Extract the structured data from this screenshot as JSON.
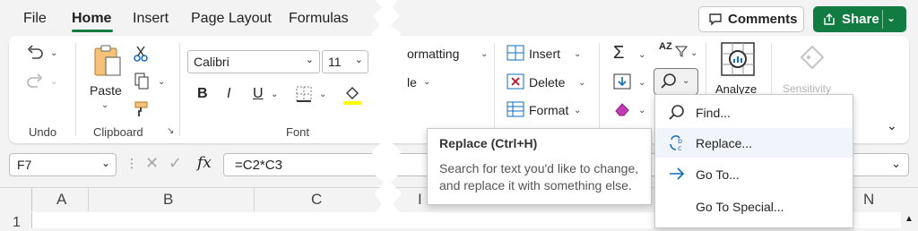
{
  "menu": {
    "tabs": [
      "File",
      "Home",
      "Insert",
      "Page Layout",
      "Formulas"
    ],
    "active": "Home"
  },
  "header_buttons": {
    "comments": "Comments",
    "share": "Share"
  },
  "ribbon": {
    "undo_group": "Undo",
    "clipboard": {
      "paste": "Paste",
      "label": "Clipboard"
    },
    "font": {
      "name": "Calibri",
      "size": "11",
      "bold": "B",
      "italic": "I",
      "underline": "U",
      "label": "Font"
    },
    "styles": {
      "conditional_fragment": "ormatting",
      "table_fragment": "le"
    },
    "cells": {
      "insert": "Insert",
      "delete": "Delete",
      "format": "Format"
    },
    "editing": {
      "sort_filter_glyph": "AZ"
    },
    "analyze": "Analyze",
    "sensitivity": "Sensitivity"
  },
  "formula_bar": {
    "name_box": "F7",
    "fx": "fx",
    "formula": "=C2*C3"
  },
  "grid": {
    "columns": [
      "A",
      "B",
      "C",
      "I",
      "N"
    ],
    "first_row": "1"
  },
  "tooltip": {
    "title": "Replace (Ctrl+H)",
    "body": "Search for text you'd like to change, and replace it with something else."
  },
  "find_menu": {
    "items": [
      {
        "label": "Find...",
        "icon": "magnifier-icon"
      },
      {
        "label": "Replace...",
        "icon": "replace-icon"
      },
      {
        "label": "Go To...",
        "icon": "arrow-right-icon"
      },
      {
        "label": "Go To Special...",
        "icon": ""
      }
    ]
  },
  "colors": {
    "accent": "#107c41",
    "highlight_yellow": "#ffff00",
    "link_blue": "#0f6cbd"
  }
}
